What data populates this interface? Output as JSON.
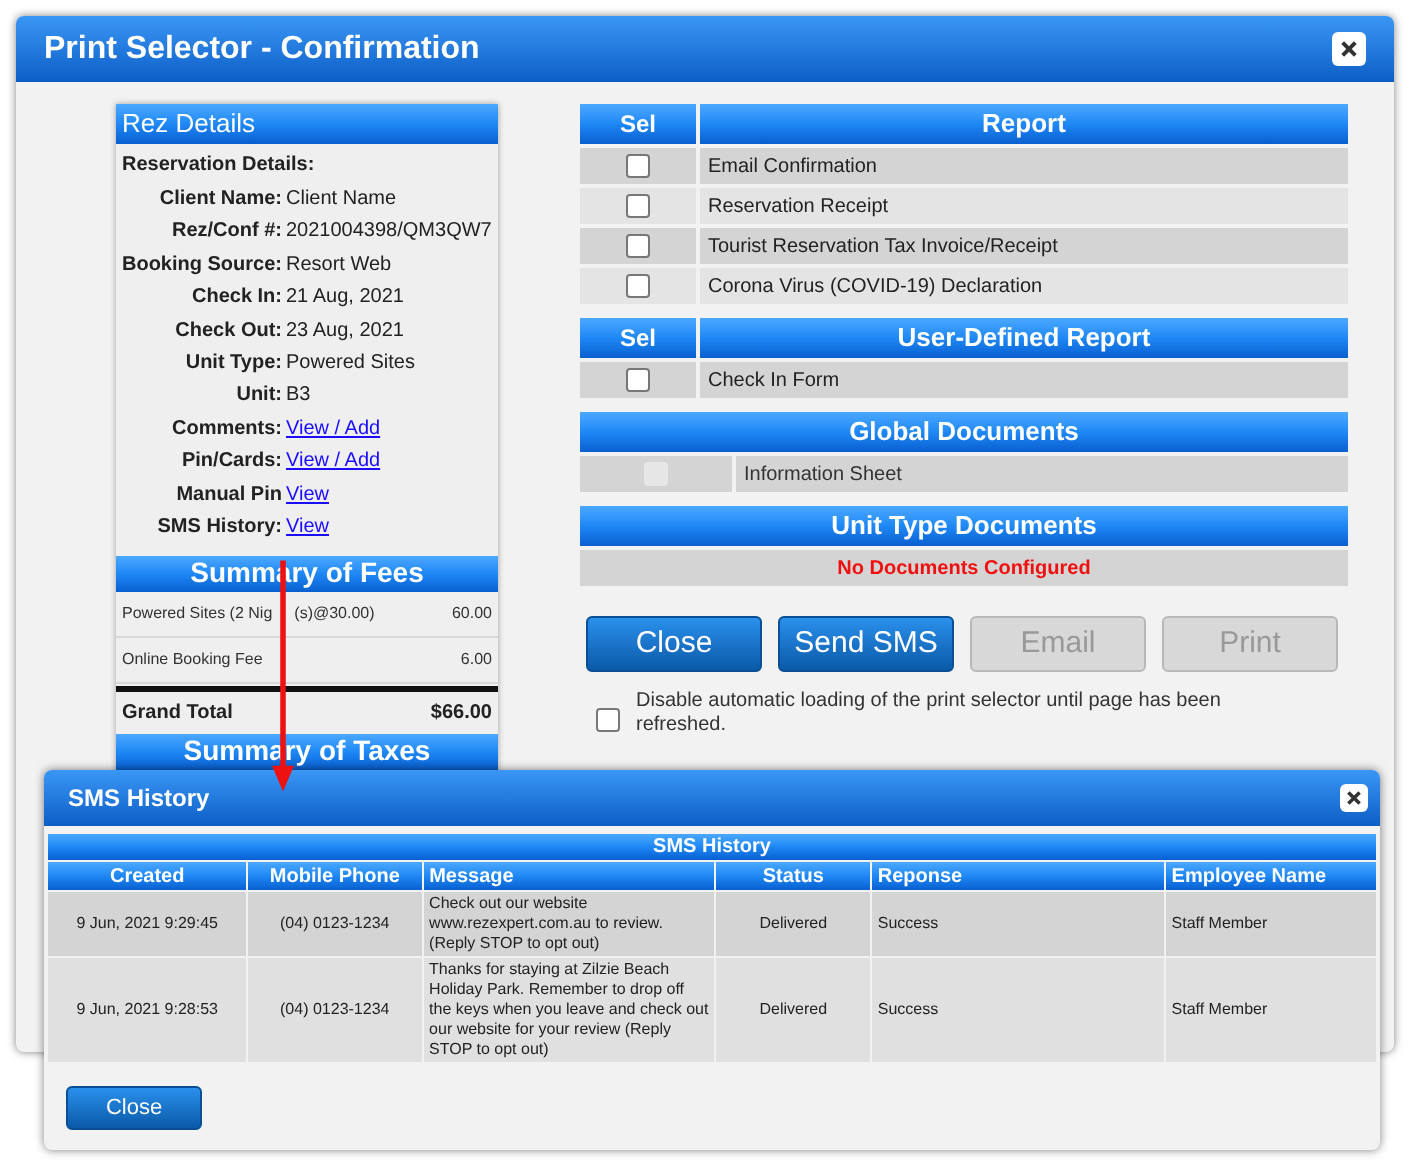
{
  "window": {
    "title": "Print Selector - Confirmation"
  },
  "rez_details": {
    "title": "Rez Details",
    "section_label": "Reservation Details:",
    "fields": [
      {
        "label": "Client Name:",
        "value": "Client Name",
        "kind": "text"
      },
      {
        "label": "Rez/Conf #:",
        "value": "2021004398/QM3QW7",
        "kind": "text"
      },
      {
        "label": "Booking Source:",
        "value": "Resort Web",
        "kind": "text"
      },
      {
        "label": "Check In:",
        "value": "21 Aug, 2021",
        "kind": "text"
      },
      {
        "label": "Check Out:",
        "value": "23 Aug, 2021",
        "kind": "text"
      },
      {
        "label": "Unit Type:",
        "value": "Powered Sites",
        "kind": "text"
      },
      {
        "label": "Unit:",
        "value": "B3",
        "kind": "text"
      },
      {
        "label": "Comments:",
        "value": "View / Add",
        "kind": "link"
      },
      {
        "label": "Pin/Cards:",
        "value": "View / Add",
        "kind": "link"
      },
      {
        "label": "Manual Pin",
        "value": "View",
        "kind": "link"
      },
      {
        "label": "SMS History:",
        "value": "View",
        "kind": "link"
      }
    ]
  },
  "summary_of_fees": {
    "title": "Summary of Fees",
    "items": [
      {
        "description_parts": [
          "Powered Sites (2 Nig",
          "(s)@30.00)"
        ],
        "amount": "60.00"
      },
      {
        "description_parts": [
          "Online Booking Fee"
        ],
        "amount": "6.00"
      }
    ],
    "total": {
      "label": "Grand Total",
      "amount": "$66.00"
    }
  },
  "summary_of_taxes": {
    "title": "Summary of Taxes"
  },
  "report_table": {
    "columns": [
      "Sel",
      "Report"
    ],
    "rows": [
      {
        "label": "Email Confirmation",
        "checked": false
      },
      {
        "label": "Reservation Receipt",
        "checked": false
      },
      {
        "label": "Tourist Reservation Tax Invoice/Receipt",
        "checked": false
      },
      {
        "label": "Corona Virus (COVID-19) Declaration",
        "checked": false
      }
    ]
  },
  "user_defined_table": {
    "columns": [
      "Sel",
      "User-Defined Report"
    ],
    "rows": [
      {
        "label": "Check In Form",
        "checked": false
      }
    ]
  },
  "global_documents": {
    "title": "Global Documents",
    "rows": [
      {
        "label": "Information Sheet",
        "checked": false,
        "disabled": true
      }
    ]
  },
  "unit_type_documents": {
    "title": "Unit Type Documents",
    "message": "No Documents Configured"
  },
  "buttons": [
    {
      "label": "Close",
      "disabled": false
    },
    {
      "label": "Send SMS",
      "disabled": false
    },
    {
      "label": "Email",
      "disabled": true
    },
    {
      "label": "Print",
      "disabled": true
    }
  ],
  "disable_autoload": {
    "label": "Disable automatic loading of the print selector until page has been refreshed.",
    "checked": false
  },
  "sms_dialog": {
    "title": "SMS History",
    "table": {
      "title": "SMS History",
      "columns": [
        "Created",
        "Mobile Phone",
        "Message",
        "Status",
        "Reponse",
        "Employee Name"
      ],
      "rows": [
        {
          "created": "9 Jun, 2021 9:29:45",
          "phone": "(04) 0123-1234",
          "message": "Check out our website www.rezexpert.com.au to review. (Reply STOP to opt out)",
          "status": "Delivered",
          "response": "Success",
          "employee": "Staff Member"
        },
        {
          "created": "9 Jun, 2021 9:28:53",
          "phone": "(04) 0123-1234",
          "message": "Thanks for staying at Zilzie Beach Holiday Park. Remember to drop off the keys when you leave and check out our website for your review (Reply STOP to opt out)",
          "status": "Delivered",
          "response": "Success",
          "employee": "Staff Member"
        }
      ]
    },
    "close_button": "Close"
  }
}
